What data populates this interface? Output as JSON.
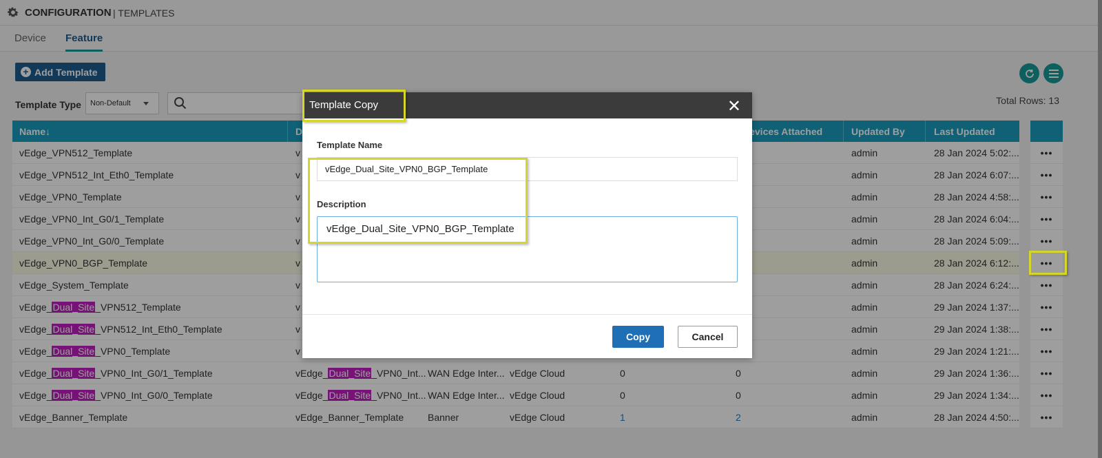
{
  "header": {
    "title": "CONFIGURATION",
    "subtitle": "| TEMPLATES",
    "icon": "gear-icon"
  },
  "tabs": [
    {
      "label": "Device",
      "active": false
    },
    {
      "label": "Feature",
      "active": true
    }
  ],
  "toolbar": {
    "add_template_label": "Add Template",
    "template_type_label": "Template Type",
    "template_type_value": "Non-Default",
    "total_rows": "Total Rows: 13"
  },
  "table": {
    "columns": [
      "Name",
      "D",
      "Devices Attached",
      "Updated By",
      "Last Updated"
    ],
    "rows": [
      {
        "name": "vEdge_VPN512_Template",
        "desc": "v",
        "updated_by": "admin",
        "last_updated": "28 Jan 2024 5:02:..."
      },
      {
        "name": "vEdge_VPN512_Int_Eth0_Template",
        "desc": "v",
        "updated_by": "admin",
        "last_updated": "28 Jan 2024 6:07:..."
      },
      {
        "name": "vEdge_VPN0_Template",
        "desc": "v",
        "updated_by": "admin",
        "last_updated": "28 Jan 2024 4:58:..."
      },
      {
        "name": "vEdge_VPN0_Int_G0/1_Template",
        "desc": "v",
        "updated_by": "admin",
        "last_updated": "28 Jan 2024 6:04:..."
      },
      {
        "name": "vEdge_VPN0_Int_G0/0_Template",
        "desc": "v",
        "updated_by": "admin",
        "last_updated": "28 Jan 2024 5:09:..."
      },
      {
        "name": "vEdge_VPN0_BGP_Template",
        "desc": "v",
        "updated_by": "admin",
        "last_updated": "28 Jan 2024 6:12:..."
      },
      {
        "name": "vEdge_System_Template",
        "desc": "v",
        "updated_by": "admin",
        "last_updated": "28 Jan 2024 6:24:..."
      },
      {
        "name_pre": "vEdge_",
        "name_tag": "Dual_Site",
        "name_post": "_VPN512_Template",
        "desc": "v",
        "updated_by": "admin",
        "last_updated": "29 Jan 2024 1:37:..."
      },
      {
        "name_pre": "vEdge_",
        "name_tag": "Dual_Site",
        "name_post": "_VPN512_Int_Eth0_Template",
        "desc": "v",
        "updated_by": "admin",
        "last_updated": "29 Jan 2024 1:38:..."
      },
      {
        "name_pre": "vEdge_",
        "name_tag": "Dual_Site",
        "name_post": "_VPN0_Template",
        "desc": "v",
        "updated_by": "admin",
        "last_updated": "29 Jan 2024 1:21:..."
      },
      {
        "name_pre": "vEdge_",
        "name_tag": "Dual_Site",
        "name_post": "_VPN0_Int_G0/1_Template",
        "desc_pre": "vEdge_",
        "desc_tag": "Dual_Site",
        "desc_post": "_VPN0_Int...",
        "type": "WAN Edge Inter...",
        "device_model": "vEdge Cloud",
        "device_templates": "0",
        "devices_attached": "0",
        "updated_by": "admin",
        "last_updated": "29 Jan 2024 1:36:..."
      },
      {
        "name_pre": "vEdge_",
        "name_tag": "Dual_Site",
        "name_post": "_VPN0_Int_G0/0_Template",
        "desc_pre": "vEdge_",
        "desc_tag": "Dual_Site",
        "desc_post": "_VPN0_Int...",
        "type": "WAN Edge Inter...",
        "device_model": "vEdge Cloud",
        "device_templates": "0",
        "devices_attached": "0",
        "updated_by": "admin",
        "last_updated": "29 Jan 2024 1:34:..."
      },
      {
        "name": "vEdge_Banner_Template",
        "desc": "vEdge_Banner_Template",
        "type": "Banner",
        "device_model": "vEdge Cloud",
        "device_templates": "1",
        "devices_attached": "2",
        "updated_by": "admin",
        "last_updated": "28 Jan 2024 4:50:..."
      }
    ],
    "actions_label": "•••"
  },
  "modal": {
    "title": "Template Copy",
    "close_label": "✕",
    "name_label": "Template Name",
    "name_value": "vEdge_Dual_Site_VPN0_BGP_Template",
    "desc_label": "Description",
    "desc_value": "vEdge_Dual_Site_VPN0_BGP_Template",
    "copy_label": "Copy",
    "cancel_label": "Cancel"
  },
  "colors": {
    "header_blue": "#1b9bbf",
    "primary": "#1e6fb5",
    "teal": "#1b9a9a",
    "highlight_tag": "#c020c0",
    "callout": "#d6d62a"
  }
}
